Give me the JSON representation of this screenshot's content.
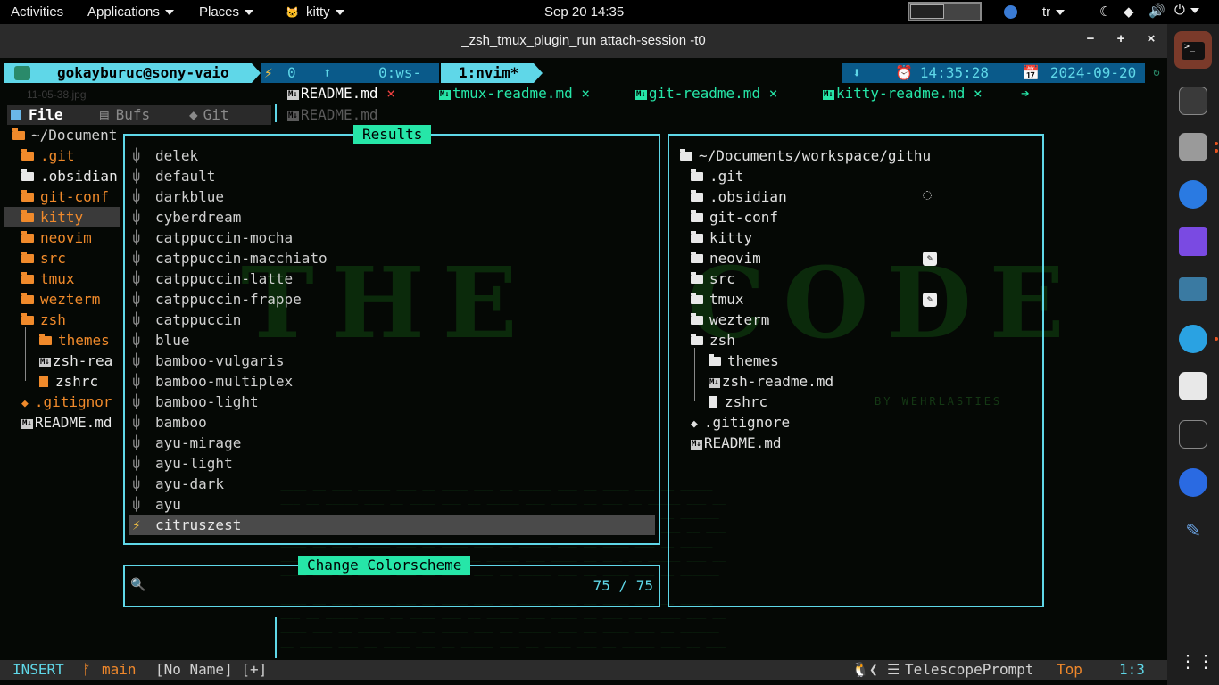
{
  "topbar": {
    "activities": "Activities",
    "applications": "Applications",
    "places": "Places",
    "app_name": "kitty",
    "clock": "Sep 20  14:35",
    "lang": "tr"
  },
  "window": {
    "title": "_zsh_tmux_plugin_run attach-session -t0",
    "minimize": "−",
    "maximize": "+",
    "close": "×"
  },
  "tmux": {
    "user_host": "gokayburuc@sony-vaio",
    "bolt": "⚡",
    "count": "0",
    "win0": "0:ws-",
    "win1": "1:nvim*",
    "time": "14:35:28",
    "date": "2024-09-20",
    "desktop_file": "11-05-38.jpg"
  },
  "tabline": {
    "tabs": [
      "README.md",
      "tmux-readme.md",
      "git-readme.md",
      "kitty-readme.md"
    ],
    "md_icon": "M↓",
    "close": "×",
    "arrow": "➔"
  },
  "sidebar": {
    "file_tab": "File",
    "bufs_tab": "Bufs",
    "git_tab": "Git",
    "winbar": "README.md",
    "root": "~/Document",
    "items": [
      ".git",
      ".obsidian",
      "git-conf",
      "kitty",
      "neovim",
      "src",
      "tmux",
      "wezterm",
      "zsh",
      "themes",
      "zsh-rea",
      "zshrc",
      ".gitignor",
      "README.md"
    ]
  },
  "telescope": {
    "results_title": "Results",
    "results": [
      "delek",
      "default",
      "darkblue",
      "cyberdream",
      "catppuccin-mocha",
      "catppuccin-macchiato",
      "catppuccin-latte",
      "catppuccin-frappe",
      "catppuccin",
      "blue",
      "bamboo-vulgaris",
      "bamboo-multiplex",
      "bamboo-light",
      "bamboo",
      "ayu-mirage",
      "ayu-light",
      "ayu-dark",
      "ayu",
      "citruszest"
    ],
    "selected": "citruszest",
    "prompt_title": "Change Colorscheme",
    "prompt_icon": "🔍",
    "counter": "75 / 75",
    "preview_root": "~/Documents/workspace/githu",
    "preview_items": [
      ".git",
      ".obsidian",
      "git-conf",
      "kitty",
      "neovim",
      "src",
      "tmux",
      "wezterm",
      "zsh",
      "themes",
      "zsh-readme.md",
      "zshrc",
      ".gitignore",
      "README.md"
    ]
  },
  "statusline": {
    "mode": "INSERT",
    "branch_icon": "ᚠ",
    "branch": "main",
    "file": "[No Name] [+]",
    "filetype": "TelescopePrompt",
    "position": "Top",
    "cursor": "1:3"
  },
  "colors": {
    "accent_cyan": "#5fd7e8",
    "accent_green": "#26e6a8",
    "folder_orange": "#f08a2b",
    "tmux_blue": "#1e96d6",
    "statusline_orange": "#f0882b"
  }
}
